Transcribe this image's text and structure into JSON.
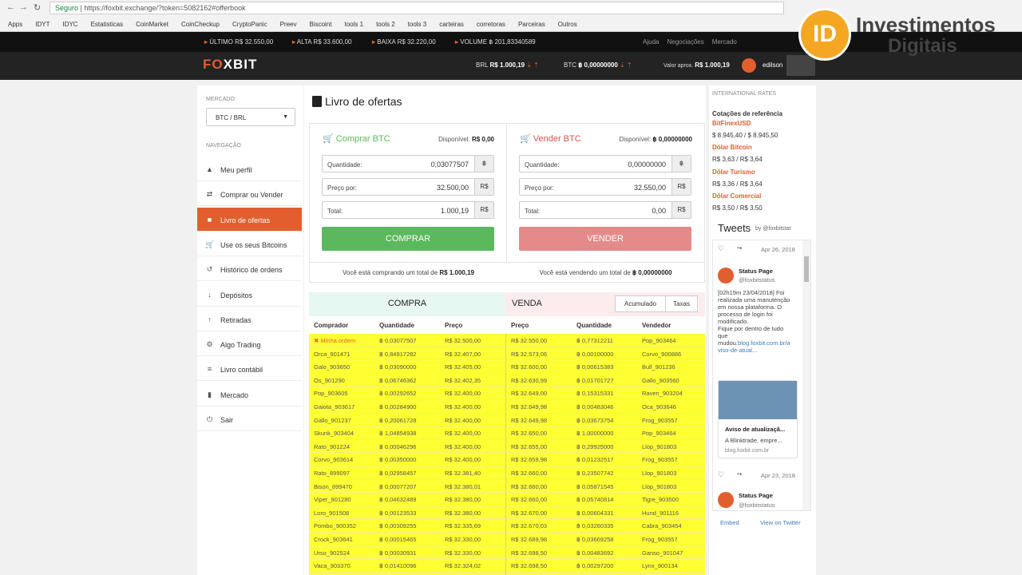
{
  "browser": {
    "secure": "Seguro",
    "url": "https://foxbit.exchange/?token=5082162#offerbook",
    "bookmarks": [
      "Apps",
      "IDYT",
      "IDYC",
      "Estatisticas",
      "CoinMarket",
      "CoinCheckup",
      "CryptoPanic",
      "Preev",
      "Biscoint",
      "tools 1",
      "tools 2",
      "tools 3",
      "carteiras",
      "corretoras",
      "Parceiras",
      "Outros"
    ]
  },
  "ticker": {
    "ultimo_label": "ÚLTIMO",
    "ultimo": "R$ 32.550,00",
    "alta_label": "ALTA",
    "alta": "R$ 33.600,00",
    "baixa_label": "BAIXA",
    "baixa": "R$ 32.220,00",
    "volume_label": "VOLUME",
    "volume": "฿ 201,83340589"
  },
  "topnav": [
    "Ajuda",
    "Negociações",
    "Mercado"
  ],
  "header": {
    "logo_a": "F",
    "logo_b": "O",
    "logo_c": "XBIT",
    "brl_label": "BRL",
    "brl": "R$ 1.000,19",
    "btc_label": "BTC",
    "btc": "฿ 0,00000000",
    "approx_label": "Valor aprox.",
    "approx": "R$ 1.000,19",
    "user": "edilson"
  },
  "watermark": {
    "l1": "Investimentos",
    "l2": "Digitais",
    "circle": "ID"
  },
  "sidebar": {
    "mercado_label": "MERCADO:",
    "market": "BTC / BRL",
    "nav_label": "NAVEGAÇÃO",
    "items": [
      {
        "label": "Meu perfil",
        "icon": "▲"
      },
      {
        "label": "Comprar ou Vender",
        "icon": "⇄"
      },
      {
        "label": "Livro de ofertas",
        "icon": "■"
      },
      {
        "label": "Use os seus Bitcoins",
        "icon": "🛒"
      },
      {
        "label": "Histórico de ordens",
        "icon": "↺"
      },
      {
        "label": "Depósitos",
        "icon": "↓"
      },
      {
        "label": "Retiradas",
        "icon": "↑"
      },
      {
        "label": "Algo Trading",
        "icon": "⚙"
      },
      {
        "label": "Livro contábil",
        "icon": "≡"
      },
      {
        "label": "Mercado",
        "icon": "▮"
      },
      {
        "label": "Sair",
        "icon": "⏻"
      }
    ]
  },
  "page": {
    "title": "Livro de ofertas"
  },
  "buy": {
    "title": "Comprar BTC",
    "avail_label": "Disponível:",
    "avail": "R$ 0,00",
    "qty_label": "Quantidade:",
    "qty": "0,03077507",
    "qty_unit": "฿",
    "price_label": "Preço por:",
    "price": "32.500,00",
    "price_unit": "R$",
    "total_label": "Total:",
    "total": "1.000,19",
    "total_unit": "R$",
    "button": "COMPRAR",
    "summary_a": "Você está comprando um total de",
    "summary_b": "R$ 1.000,19"
  },
  "sell": {
    "title": "Vender BTC",
    "avail_label": "Disponível:",
    "avail": "฿ 0,00000000",
    "qty_label": "Quantidade:",
    "qty": "0,00000000",
    "qty_unit": "฿",
    "price_label": "Preço por:",
    "price": "32.550,00",
    "price_unit": "R$",
    "total_label": "Total:",
    "total": "0,00",
    "total_unit": "R$",
    "button": "VENDER",
    "summary_a": "Você está vendendo um total de",
    "summary_b": "฿ 0,00000000"
  },
  "book": {
    "buy_title": "COMPRA",
    "sell_title": "VENDA",
    "tab1": "Acumulado",
    "tab2": "Taxas",
    "cols": [
      "Comprador",
      "Quantidade",
      "Preço",
      "Preço",
      "Quantidade",
      "Vendedor"
    ],
    "rows": [
      [
        "✖ Minha ordem",
        "฿ 0,03077507",
        "R$ 32.500,00",
        "R$ 32.550,00",
        "฿ 0,77312211",
        "Pop_903464"
      ],
      [
        "Orca_901471",
        "฿ 0,84917282",
        "R$ 32.407,00",
        "R$ 32.573,06",
        "฿ 0,00100000",
        "Corvo_900886"
      ],
      [
        "Galo_903650",
        "฿ 0,03090000",
        "R$ 32.405,00",
        "R$ 32.600,00",
        "฿ 0,00615383",
        "Bull_901236"
      ],
      [
        "Os_901290",
        "฿ 0,06746362",
        "R$ 32.402,35",
        "R$ 32.630,99",
        "฿ 0,01701727",
        "Gallo_903560"
      ],
      [
        "Pop_903605",
        "฿ 0,00292652",
        "R$ 32.400,00",
        "R$ 32.649,00",
        "฿ 0,15315331",
        "Raven_903204"
      ],
      [
        "Gaiota_903617",
        "฿ 0,00284900",
        "R$ 32.400,00",
        "R$ 32.649,98",
        "฿ 0,00483046",
        "Oca_903646"
      ],
      [
        "Gallo_901237",
        "฿ 0,20061728",
        "R$ 32.400,00",
        "R$ 32.649,98",
        "฿ 0,03673754",
        "Frog_903557"
      ],
      [
        "Skunk_903404",
        "฿ 1,04854938",
        "R$ 32.400,00",
        "R$ 32.650,00",
        "฿ 1,00000000",
        "Pop_903464"
      ],
      [
        "Rato_901224",
        "฿ 0,00046296",
        "R$ 32.400,00",
        "R$ 32.655,00",
        "฿ 0,29925000",
        "Llop_901803"
      ],
      [
        "Corvo_903614",
        "฿ 0,00350000",
        "R$ 32.400,00",
        "R$ 32.659,98",
        "฿ 0,01232517",
        "Frog_903557"
      ],
      [
        "Rato_899097",
        "฿ 0,02958457",
        "R$ 32.381,40",
        "R$ 32.660,00",
        "฿ 0,23507742",
        "Llop_901803"
      ],
      [
        "Bison_899470",
        "฿ 0,00077207",
        "R$ 32.380,01",
        "R$ 32.660,00",
        "฿ 0,05871545",
        "Llop_901803"
      ],
      [
        "Viper_901280",
        "฿ 0,04632489",
        "R$ 32.380,00",
        "R$ 32.660,00",
        "฿ 0,05740814",
        "Tigre_903500"
      ],
      [
        "Loro_901508",
        "฿ 0,00123533",
        "R$ 32.380,00",
        "R$ 32.670,00",
        "฿ 0,00604331",
        "Hund_901116"
      ],
      [
        "Pombo_900352",
        "฿ 0,00309255",
        "R$ 32.335,69",
        "R$ 32.670,03",
        "฿ 0,03260335",
        "Cabra_903454"
      ],
      [
        "Crock_903641",
        "฿ 0,00015465",
        "R$ 32.330,00",
        "R$ 32.689,98",
        "฿ 0,03669258",
        "Frog_903557"
      ],
      [
        "Urso_902524",
        "฿ 0,00030931",
        "R$ 32.330,00",
        "R$ 32.698,50",
        "฿ 0,00483692",
        "Ganso_901047"
      ],
      [
        "Vaca_903370",
        "฿ 0,01410096",
        "R$ 32.324,02",
        "R$ 32.698,50",
        "฿ 0,00297200",
        "Lynx_900134"
      ]
    ]
  },
  "rates": {
    "title": "INTERNATIONAL RATES",
    "sub": "Cotações de referência",
    "items": [
      {
        "name": "BitFinexUSD",
        "value": "$ 8.945,40 / $ 8.945,50"
      },
      {
        "name": "Dólar Bitcoin",
        "value": "R$ 3,63 / R$ 3,64"
      },
      {
        "name": "Dólar Turismo",
        "value": "R$ 3,36 / R$ 3,64"
      },
      {
        "name": "Dólar Comercial",
        "value": "R$ 3,50 / R$ 3,50"
      }
    ]
  },
  "tweets": {
    "title": "Tweets",
    "by": "by @foxbitstat",
    "date1": "Apr 26, 2018",
    "name1": "Status Page",
    "handle1": "@foxbitstatus",
    "body1": [
      "[02h19m 23/04/2018] Foi",
      "realizada uma manutenção",
      "em nossa plataforma. O",
      "processo de login foi",
      "modificado.",
      "Fique por dentro de tudo",
      "que"
    ],
    "mudou": "mudou.",
    "link1": "blog.foxbit.com.br/a",
    "link2": "viso-de-atual...",
    "card_title": "Aviso de atualizaçã...",
    "card_desc": "A Blinktrade, empre...",
    "card_url": "blog.foxbit.com.br",
    "date2": "Apr 23, 2018",
    "name2": "Status Page",
    "handle2": "@foxbitstatus",
    "embed": "Embed",
    "view": "View on Twitter"
  }
}
